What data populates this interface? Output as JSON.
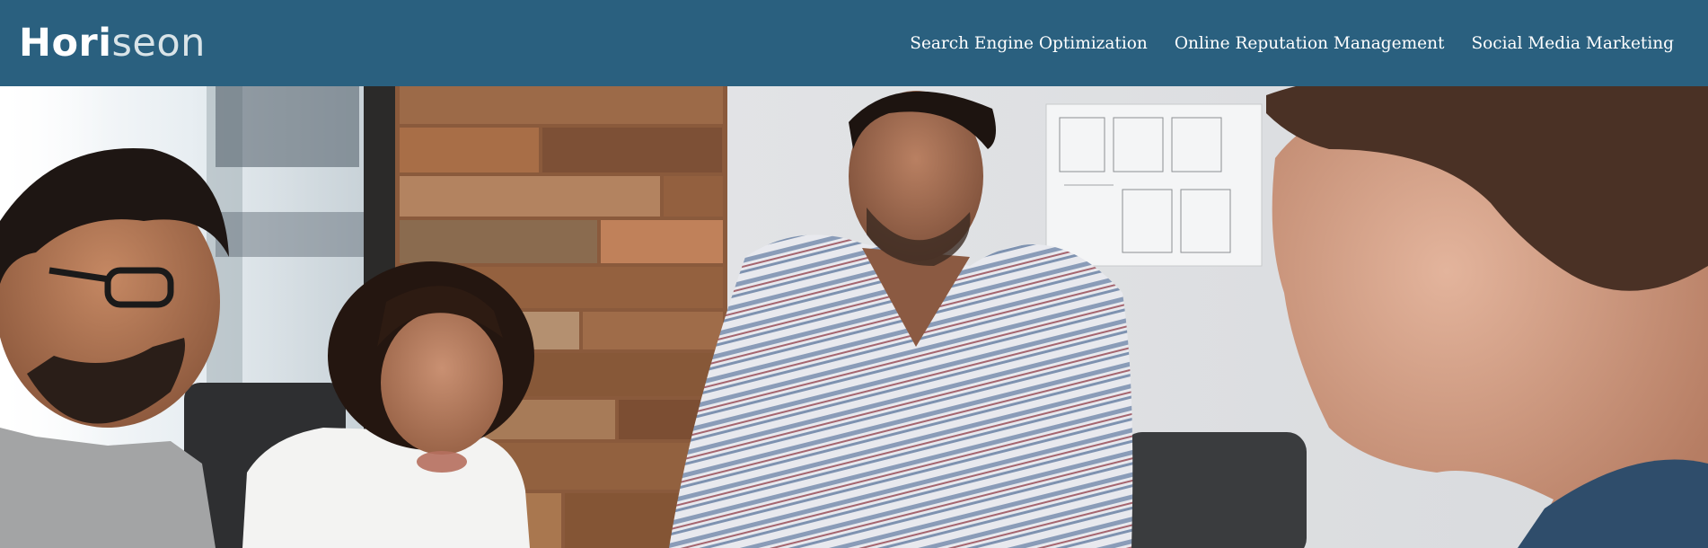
{
  "header": {
    "logo_part1": "Hori",
    "logo_part2": "seon",
    "nav": [
      {
        "label": "Search Engine Optimization"
      },
      {
        "label": "Online Reputation Management"
      },
      {
        "label": "Social Media Marketing"
      }
    ]
  },
  "hero": {
    "icon": "team-meeting-photo"
  },
  "colors": {
    "header_bg": "#2a607f",
    "nav_text": "#ffffff",
    "logo_text": "#ffffff",
    "logo_accent": "#d9e4e8"
  }
}
